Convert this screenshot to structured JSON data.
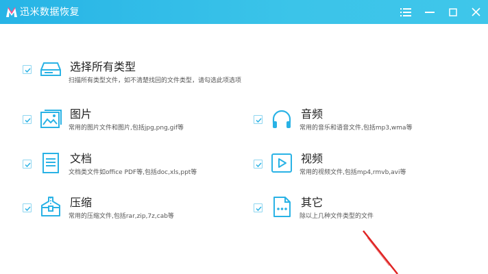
{
  "app": {
    "title": "迅米数据恢复"
  },
  "window_controls": {
    "menu": "menu-icon",
    "minimize": "minimize-icon",
    "maximize": "maximize-icon",
    "close": "close-icon"
  },
  "select_all": {
    "title": "选择所有类型",
    "desc": "扫描所有类型文件，如不清楚找回的文件类型，请勾选此项选项",
    "checked": true,
    "icon": "drive-icon"
  },
  "file_types": [
    {
      "title": "图片",
      "desc": "常用的图片文件和图片,包括jpg,png,gif等",
      "checked": true,
      "icon": "image-icon"
    },
    {
      "title": "音频",
      "desc": "常用的音乐和语音文件,包括mp3,wma等",
      "checked": true,
      "icon": "headphones-icon"
    },
    {
      "title": "文档",
      "desc": "文档类文件如office PDF等,包括doc,xls,ppt等",
      "checked": true,
      "icon": "document-icon"
    },
    {
      "title": "视频",
      "desc": "常用的视频文件,包括mp4,rmvb,avi等",
      "checked": true,
      "icon": "video-icon"
    },
    {
      "title": "压缩",
      "desc": "常用的压缩文件,包括rar,zip,7z,cab等",
      "checked": true,
      "icon": "archive-icon"
    },
    {
      "title": "其它",
      "desc": "除以上几种文件类型的文件",
      "checked": true,
      "icon": "other-icon"
    }
  ],
  "colors": {
    "titlebar": "#2fbbe8",
    "icon_accent": "#29b2e5",
    "checkbox_border": "#8fd6f0",
    "annotation_arrow": "#e02424"
  }
}
